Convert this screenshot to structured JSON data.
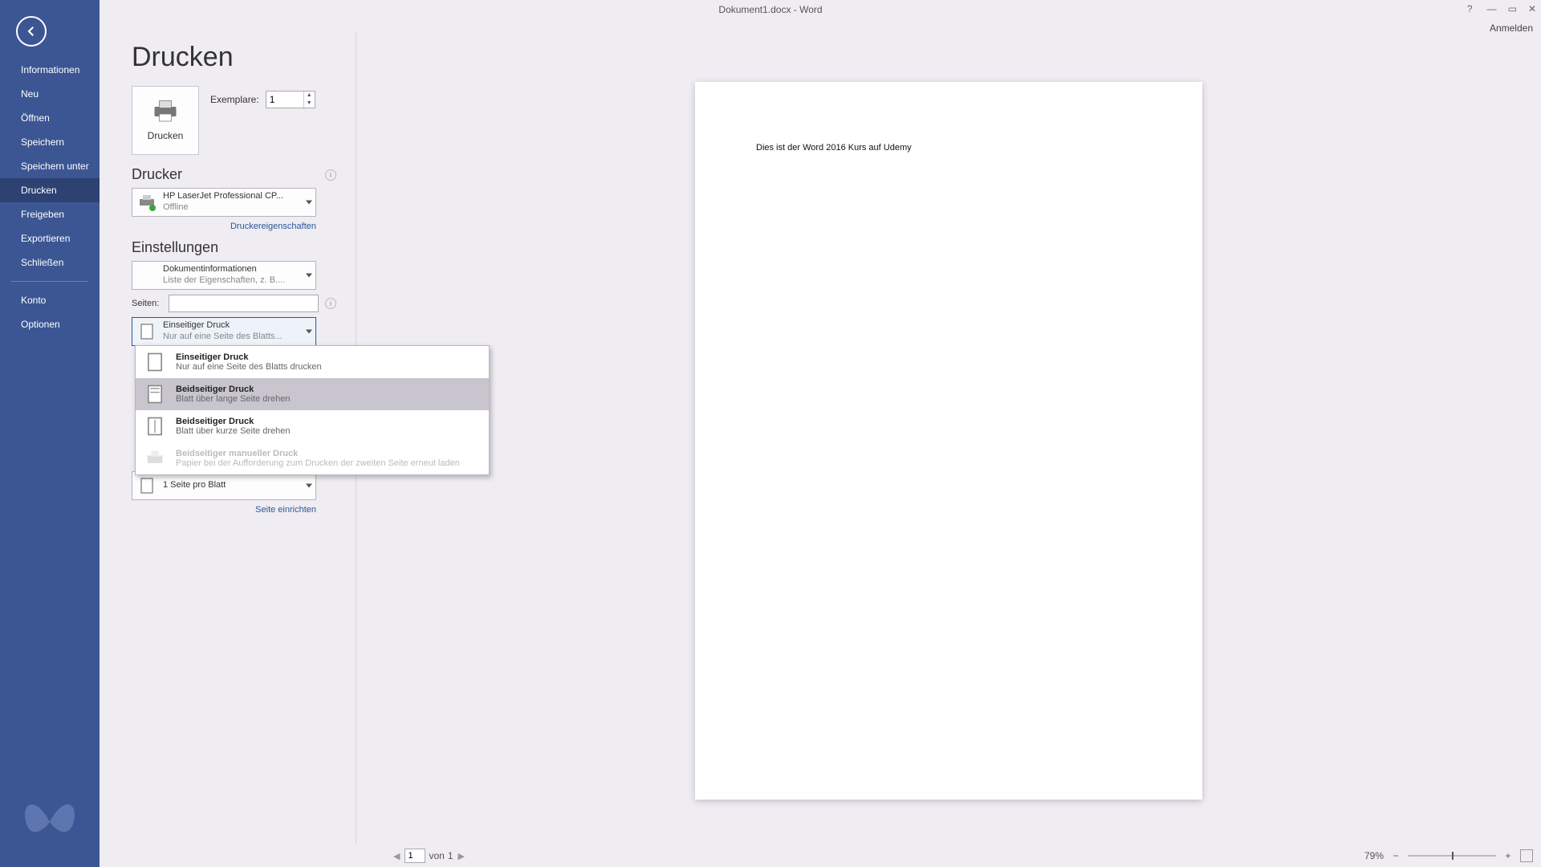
{
  "title": "Dokument1.docx - Word",
  "signin": "Anmelden",
  "window_controls": {
    "min": "—",
    "max": "▭",
    "close": "✕"
  },
  "sidebar": {
    "items": [
      "Informationen",
      "Neu",
      "Öffnen",
      "Speichern",
      "Speichern unter",
      "Drucken",
      "Freigeben",
      "Exportieren",
      "Schließen"
    ],
    "account": "Konto",
    "options": "Optionen",
    "active_index": 5
  },
  "page": {
    "title": "Drucken",
    "print_button": "Drucken",
    "copies_label": "Exemplare:",
    "copies_value": "1"
  },
  "printer": {
    "section": "Drucker",
    "name": "HP LaserJet Professional CP...",
    "status": "Offline",
    "properties_link": "Druckereigenschaften"
  },
  "settings": {
    "section": "Einstellungen",
    "docinfo_title": "Dokumentinformationen",
    "docinfo_sub": "Liste der Eigenschaften, z. B....",
    "pages_label": "Seiten:",
    "pages_value": "",
    "duplex": {
      "title": "Einseitiger Druck",
      "sub": "Nur auf eine Seite des Blatts..."
    },
    "pages_per_sheet": "1 Seite pro Blatt",
    "page_setup_link": "Seite einrichten",
    "popup": {
      "items": [
        {
          "title": "Einseitiger Druck",
          "sub": "Nur auf eine Seite des Blatts drucken",
          "state": "normal"
        },
        {
          "title": "Beidseitiger Druck",
          "sub": "Blatt über lange Seite drehen",
          "state": "hover"
        },
        {
          "title": "Beidseitiger Druck",
          "sub": "Blatt über kurze Seite drehen",
          "state": "normal"
        },
        {
          "title": "Beidseitiger manueller Druck",
          "sub": "Papier bei der Aufforderung zum Drucken der zweiten Seite erneut laden",
          "state": "disabled"
        }
      ]
    }
  },
  "preview": {
    "content": "Dies ist der Word 2016 Kurs auf Udemy"
  },
  "status": {
    "page_current": "1",
    "page_sep": "von",
    "page_total": "1",
    "zoom_percent": "79%"
  }
}
